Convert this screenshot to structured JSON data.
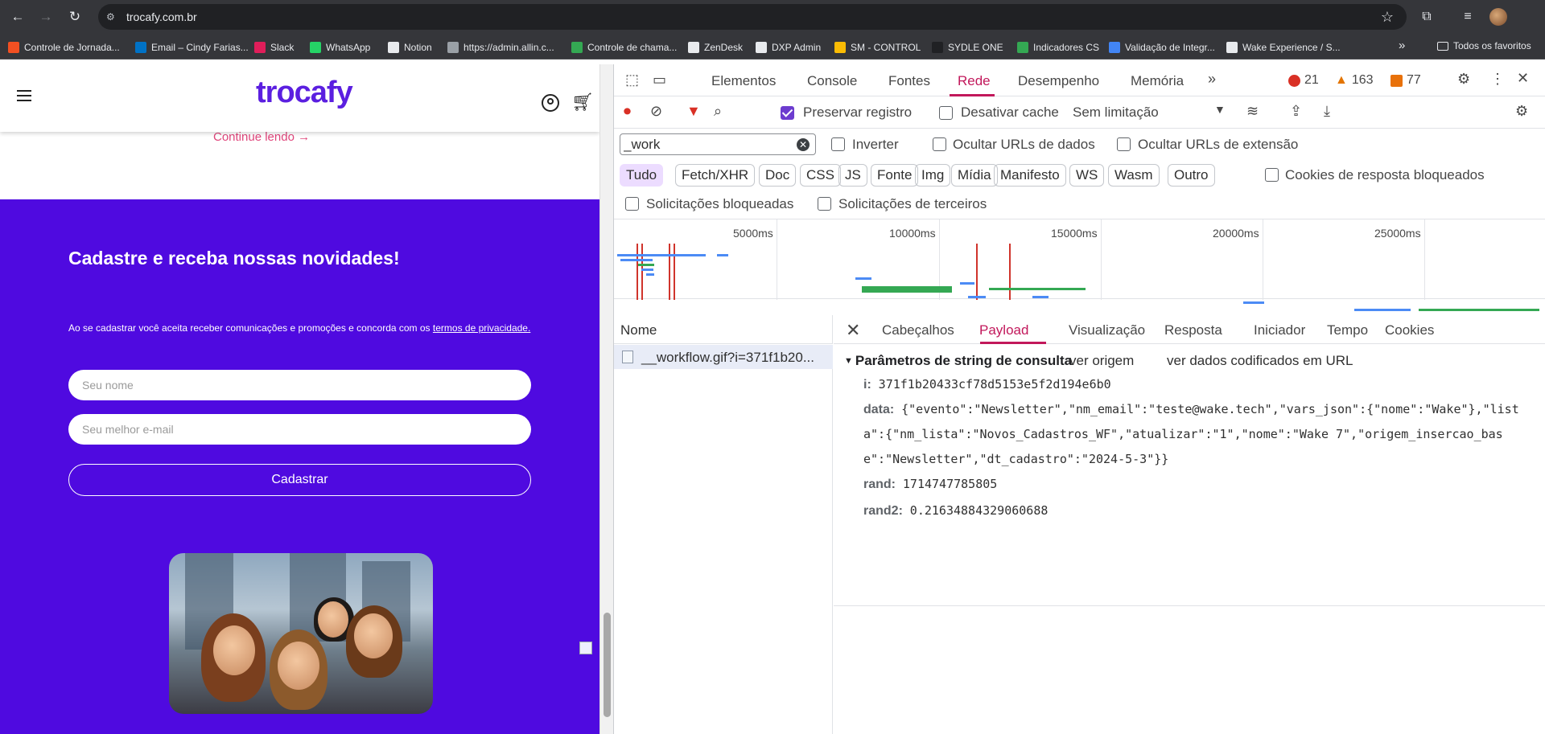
{
  "browser": {
    "url": "trocafy.com.br",
    "bookmarks": [
      {
        "label": "Controle de Jornada...",
        "color": "#f25022"
      },
      {
        "label": "Email – Cindy Farias...",
        "color": "#0072c6"
      },
      {
        "label": "Slack",
        "color": "#e01e5a"
      },
      {
        "label": "WhatsApp",
        "color": "#25d366"
      },
      {
        "label": "Notion",
        "color": "#e8eaed"
      },
      {
        "label": "https://admin.allin.c...",
        "color": "#9aa0a6"
      },
      {
        "label": "Controle de chama...",
        "color": "#34a853"
      },
      {
        "label": "ZenDesk",
        "color": "#e8eaed"
      },
      {
        "label": "DXP Admin",
        "color": "#e8eaed"
      },
      {
        "label": "SM - CONTROL",
        "color": "#fbbc04"
      },
      {
        "label": "SYDLE ONE",
        "color": "#202124"
      },
      {
        "label": "Indicadores CS",
        "color": "#34a853"
      },
      {
        "label": "Validação de Integr...",
        "color": "#4285f4"
      },
      {
        "label": "Wake Experience / S...",
        "color": "#e8eaed"
      }
    ],
    "bookmarks_folder": "Todos os favoritos",
    "overflow_icon": "»"
  },
  "site": {
    "logo": "trocafy",
    "continue_link": "Continue lendo →",
    "newsletter": {
      "title": "Cadastre e receba nossas novidades!",
      "disclaimer_prefix": "Ao se cadastrar você aceita receber comunicações e promoções e concorda com os ",
      "disclaimer_link": "termos de privacidade.",
      "name_placeholder": "Seu nome",
      "email_placeholder": "Seu melhor e-mail",
      "submit_label": "Cadastrar"
    },
    "colors": {
      "brand": "#5b1fe0",
      "banner": "#4f0ae0",
      "link": "#e0457b"
    }
  },
  "devtools": {
    "tabs": [
      "Elementos",
      "Console",
      "Fontes",
      "Rede",
      "Desempenho",
      "Memória"
    ],
    "active_tab": "Rede",
    "errors": "21",
    "warnings": "163",
    "issues": "77",
    "toolbar": {
      "preserve_log": "Preservar registro",
      "disable_cache": "Desativar cache",
      "throttling": "Sem limitação"
    },
    "filter": {
      "value": "_work",
      "invert": "Inverter",
      "hide_data_urls": "Ocultar URLs de dados",
      "hide_extension_urls": "Ocultar URLs de extensão",
      "types": [
        "Tudo",
        "Fetch/XHR",
        "Doc",
        "CSS",
        "JS",
        "Fonte",
        "Img",
        "Mídia",
        "Manifesto",
        "WS",
        "Wasm",
        "Outro"
      ],
      "blocked_cookies": "Cookies de resposta bloqueados",
      "blocked_requests": "Solicitações bloqueadas",
      "third_party": "Solicitações de terceiros"
    },
    "timeline": {
      "ticks": [
        "5000ms",
        "10000ms",
        "15000ms",
        "20000ms",
        "25000ms"
      ]
    },
    "list": {
      "header": "Nome",
      "rows": [
        {
          "name": "__workflow.gif?i=371f1b20..."
        }
      ]
    },
    "detail": {
      "tabs": [
        "Cabeçalhos",
        "Payload",
        "Visualização",
        "Resposta",
        "Iniciador",
        "Tempo",
        "Cookies"
      ],
      "active": "Payload",
      "section_title": "Parâmetros de string de consulta",
      "view_source": "ver origem",
      "view_url_encoded": "ver dados codificados em URL",
      "params": [
        {
          "key": "i:",
          "value": "371f1b20433cf78d5153e5f2d194e6b0"
        },
        {
          "key": "data:",
          "value": "{\"evento\":\"Newsletter\",\"nm_email\":\"teste@wake.tech\",\"vars_json\":{\"nome\":\"Wake\"},\"lista\":{\"nm_lista\":\"Novos_Cadastros_WF\",\"atualizar\":\"1\",\"nome\":\"Wake 7\",\"origem_insercao_base\":\"Newsletter\",\"dt_cadastro\":\"2024-5-3\"}}"
        },
        {
          "key": "rand:",
          "value": "1714747785805"
        },
        {
          "key": "rand2:",
          "value": "0.21634884329060688"
        }
      ]
    },
    "colors": {
      "accent": "#c2185b",
      "checkbox": "#6c3ccf",
      "active_chip": "#ecdcff"
    }
  }
}
